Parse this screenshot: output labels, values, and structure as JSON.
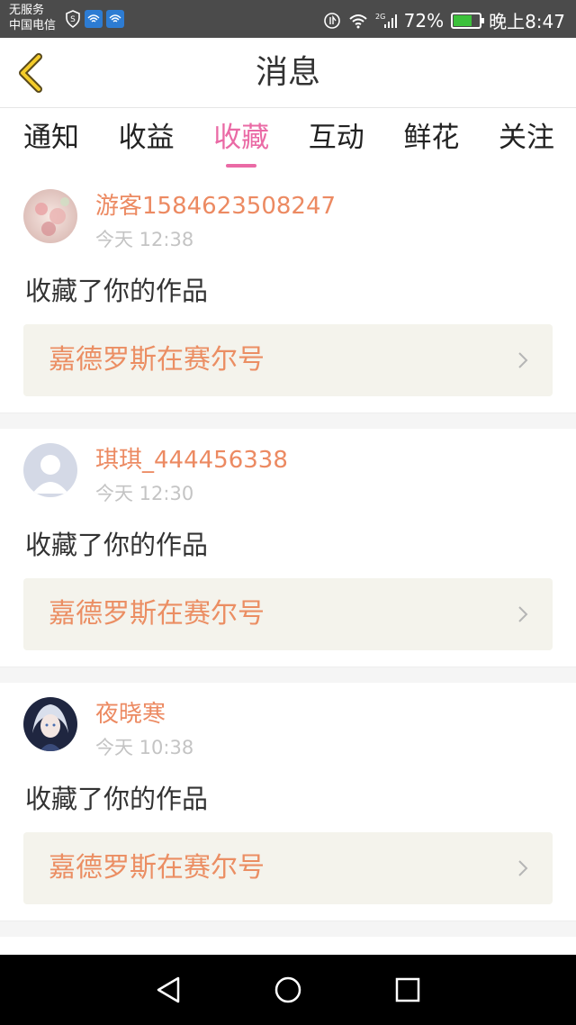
{
  "status_bar": {
    "carrier_line1": "无服务",
    "carrier_line2": "中国电信",
    "network": "2G",
    "battery": "72%",
    "battery_level": 0.72,
    "time": "晚上8:47"
  },
  "header": {
    "title": "消息",
    "back_icon": "chevron-left-icon"
  },
  "tabs": [
    {
      "label": "通知",
      "active": false
    },
    {
      "label": "收益",
      "active": false
    },
    {
      "label": "收藏",
      "active": true
    },
    {
      "label": "互动",
      "active": false
    },
    {
      "label": "鲜花",
      "active": false
    },
    {
      "label": "关注",
      "active": false
    }
  ],
  "messages": [
    {
      "username": "游客1584623508247",
      "time": "今天 12:38",
      "action": "收藏了你的作品",
      "work_title": "嘉德罗斯在赛尔号"
    },
    {
      "username": "琪琪_444456338",
      "time": "今天 12:30",
      "action": "收藏了你的作品",
      "work_title": "嘉德罗斯在赛尔号"
    },
    {
      "username": "夜晓寒",
      "time": "今天 10:38",
      "action": "收藏了你的作品",
      "work_title": "嘉德罗斯在赛尔号"
    }
  ],
  "colors": {
    "accent": "#ea6aa5",
    "username": "#ec8a62",
    "work_title": "#eb8e63",
    "card_bg": "#f4f3ec"
  }
}
